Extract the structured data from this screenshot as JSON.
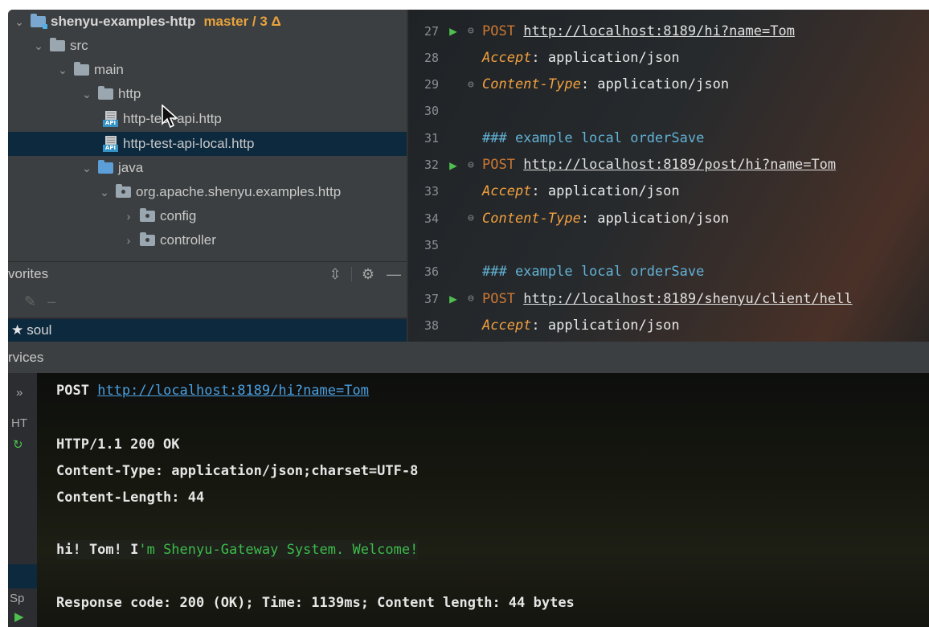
{
  "project_tree": {
    "items": [
      {
        "label": "shenyu-examples-http",
        "branch": "master / 3 Δ",
        "icon": "module-folder-icon",
        "expanded": true
      },
      {
        "label": "src",
        "icon": "folder-icon",
        "expanded": true
      },
      {
        "label": "main",
        "icon": "folder-icon",
        "expanded": true
      },
      {
        "label": "http",
        "icon": "folder-icon",
        "expanded": true
      },
      {
        "label": "http-test-api.http",
        "icon": "api-file-icon"
      },
      {
        "label": "http-test-api-local.http",
        "icon": "api-file-icon",
        "selected": true
      },
      {
        "label": "java",
        "icon": "source-folder-icon",
        "expanded": true
      },
      {
        "label": "org.apache.shenyu.examples.http",
        "icon": "package-icon",
        "expanded": true
      },
      {
        "label": "config",
        "icon": "package-icon",
        "expanded": false
      },
      {
        "label": "controller",
        "icon": "package-icon",
        "expanded": false
      }
    ],
    "api_badge": "API"
  },
  "favorites": {
    "title": "vorites",
    "items": [
      {
        "label": "soul",
        "icon": "star-icon"
      }
    ]
  },
  "editor": {
    "lines": [
      {
        "num": "27",
        "run": true,
        "fold": true,
        "kind": "request",
        "method": "POST",
        "url": "http://localhost:8189/hi?name=Tom"
      },
      {
        "num": "28",
        "kind": "header",
        "name": "Accept",
        "value": ": application/json"
      },
      {
        "num": "29",
        "fold": true,
        "kind": "header",
        "name": "Content-Type",
        "value": ": application/json"
      },
      {
        "num": "30",
        "kind": "blank"
      },
      {
        "num": "31",
        "kind": "comment",
        "text": "### example local orderSave"
      },
      {
        "num": "32",
        "run": true,
        "fold": true,
        "kind": "request",
        "method": "POST",
        "url": "http://localhost:8189/post/hi?name=Tom"
      },
      {
        "num": "33",
        "kind": "header",
        "name": "Accept",
        "value": ": application/json"
      },
      {
        "num": "34",
        "fold": true,
        "kind": "header",
        "name": "Content-Type",
        "value": ": application/json"
      },
      {
        "num": "35",
        "kind": "blank"
      },
      {
        "num": "36",
        "kind": "comment",
        "text": "### example local orderSave"
      },
      {
        "num": "37",
        "run": true,
        "fold": true,
        "kind": "request",
        "method": "POST",
        "url": "http://localhost:8189/shenyu/client/hell"
      },
      {
        "num": "38",
        "kind": "header",
        "name": "Accept",
        "value": ": application/json"
      }
    ]
  },
  "services": {
    "title": "rvices",
    "left_fragments": [
      "»",
      "HT",
      "Sp"
    ],
    "output": {
      "request_method": "POST",
      "request_url": "http://localhost:8189/hi?name=Tom",
      "status_line": "HTTP/1.1 200 OK",
      "content_type": "Content-Type: application/json;charset=UTF-8",
      "content_length": "Content-Length: 44",
      "body_prefix": "hi! Tom! I",
      "body_suffix": "'m Shenyu-Gateway System. Welcome!",
      "summary": "Response code: 200 (OK); Time: 1139ms; Content length: 44 bytes"
    }
  },
  "colors": {
    "accent_branch": "#e8a33d",
    "selection": "#0d293e",
    "run_gutter": "#4fbf4f",
    "link": "#4a9fe0",
    "response_body": "#3cbc4a"
  }
}
